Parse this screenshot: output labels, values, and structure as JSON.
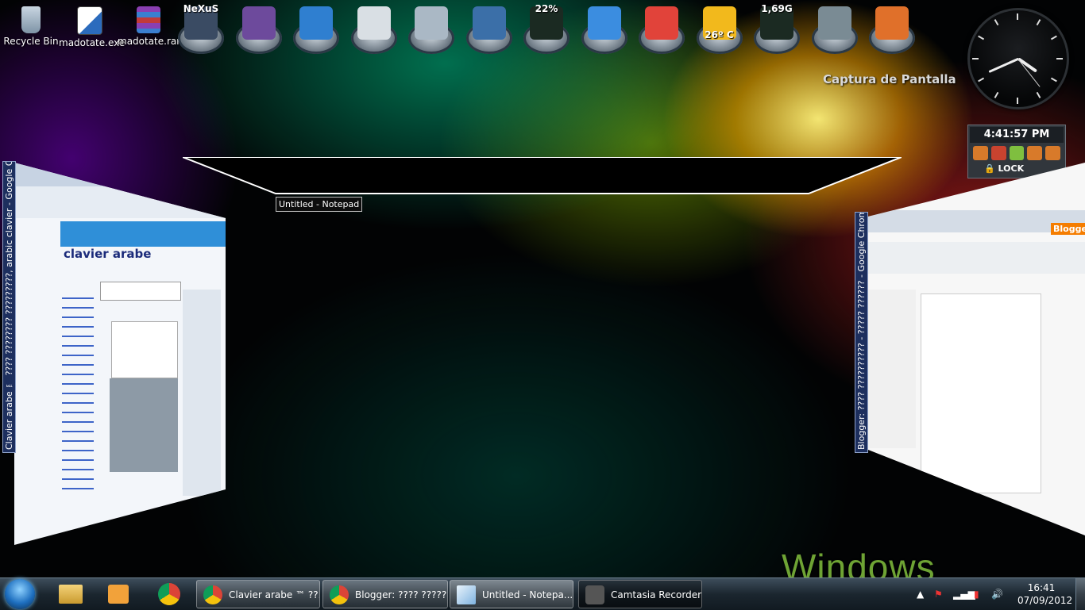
{
  "desktop": {
    "icons": [
      {
        "label": "Recycle Bin",
        "icon": "recycle-bin-icon",
        "color": "#9fb7cc"
      },
      {
        "label": "madotate.exe",
        "icon": "exe-icon",
        "color": "#2b6bbd"
      },
      {
        "label": "madotate.rar",
        "icon": "winrar-icon",
        "color": "#8a3fb2"
      }
    ],
    "dock": [
      {
        "icon": "nexus-icon",
        "text": "NeXuS",
        "color": "#3a4b63"
      },
      {
        "icon": "winrar-archive-icon",
        "text": "",
        "color": "#6d4a9c"
      },
      {
        "icon": "windows-icon",
        "text": "",
        "color": "#2f7fd0"
      },
      {
        "icon": "clock-icon",
        "text": "",
        "color": "#d9dfe4"
      },
      {
        "icon": "trash-icon",
        "text": "",
        "color": "#aab8c5"
      },
      {
        "icon": "virtualbox-icon",
        "text": "",
        "color": "#3b6fa8"
      },
      {
        "icon": "cpu-meter-icon",
        "text": "22%",
        "color": "#1b2a22"
      },
      {
        "icon": "safari-icon",
        "text": "",
        "color": "#3b8de0"
      },
      {
        "icon": "chrome-icon",
        "text": "",
        "color": "#e1433a"
      },
      {
        "icon": "weather-sun-icon",
        "text": "26º C",
        "color": "#f2b91c"
      },
      {
        "icon": "memory-meter-icon",
        "text": "1,69G",
        "color": "#1b2a22"
      },
      {
        "icon": "globe-icon",
        "text": "",
        "color": "#7a8b94"
      },
      {
        "icon": "explosion-icon",
        "text": "",
        "color": "#e0702a"
      }
    ],
    "capture_label": "Captura de Pantalla",
    "gadget_time": "4:41:57 PM",
    "lock_label": "LOCK",
    "notepad_label": "Untitled - Notepad",
    "left_window_title": "Clavier arabe ™ ???? ???????? ?????????, arabic clavier - Google Chrome",
    "right_window_title": "Blogger: ???? ?????????? - ????? ?????? - Google Chrome",
    "left_page_logo": "clavier arabe",
    "right_page_logo": "Blogger",
    "windows_logo": "Windows"
  },
  "taskbar": {
    "tasks": [
      {
        "label": "Clavier arabe ™ ??...",
        "icon": "chrome-icon",
        "color": "#e1433a"
      },
      {
        "label": "Blogger: ???? ?????...",
        "icon": "chrome-icon",
        "color": "#e1433a"
      },
      {
        "label": "Untitled - Notepa...",
        "icon": "notepad-icon",
        "color": "#7fb3e0"
      },
      {
        "label": "Camtasia Recorder",
        "icon": "camtasia-icon",
        "color": "#555555"
      }
    ],
    "time": "16:41",
    "date": "07/09/2012"
  }
}
